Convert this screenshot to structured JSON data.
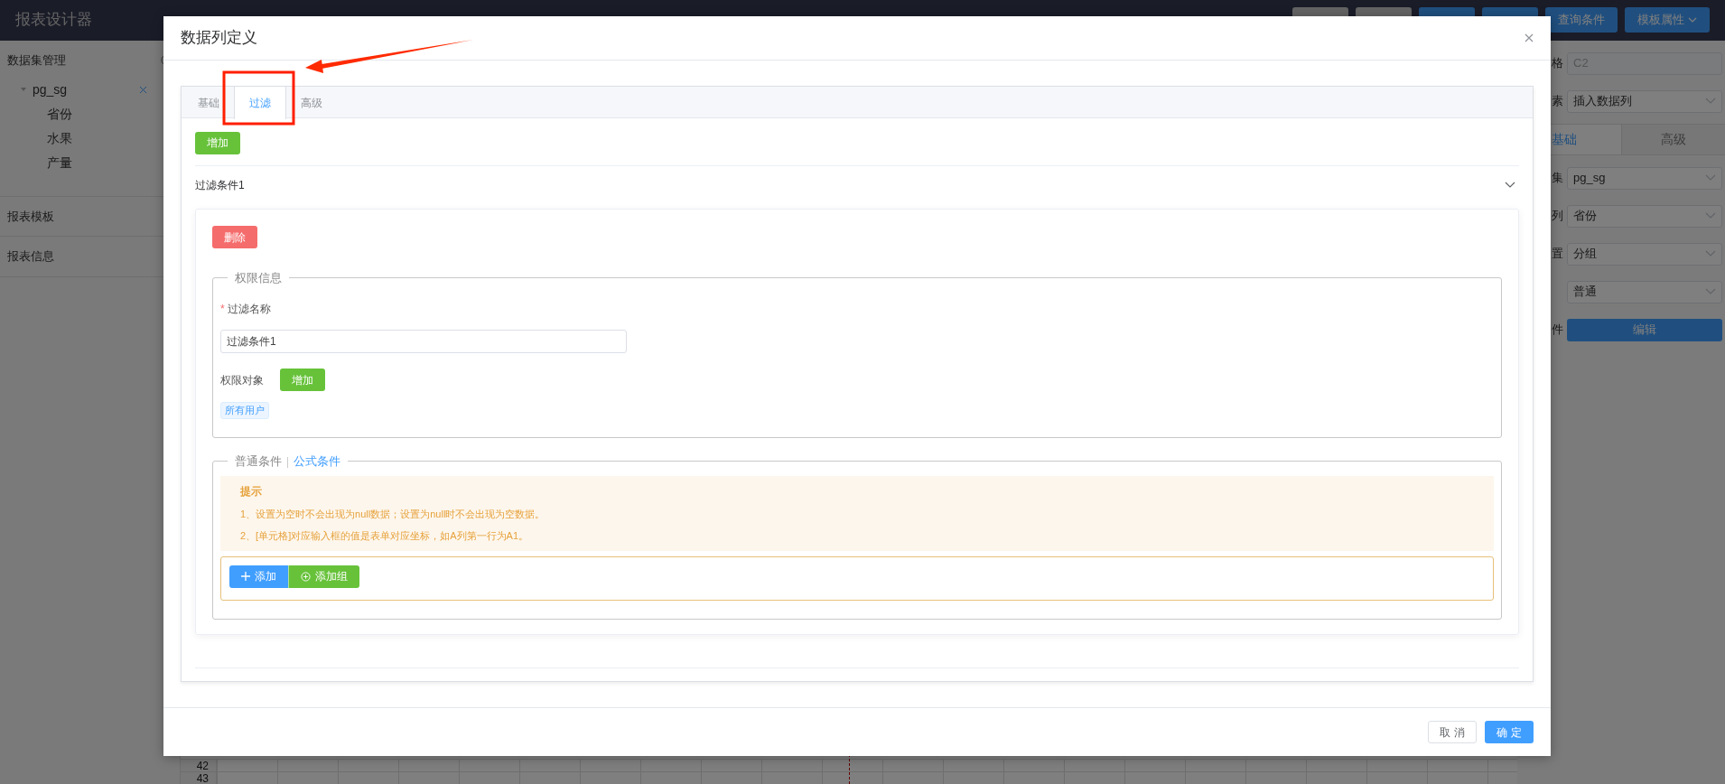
{
  "topbar": {
    "title": "报表设计器",
    "buttons": [
      {
        "kind": "default"
      },
      {
        "kind": "default"
      },
      {
        "kind": "primary"
      },
      {
        "kind": "primary"
      },
      {
        "kind": "primary",
        "label": "查询条件"
      },
      {
        "kind": "primary",
        "label": "模板属性",
        "dropdown": true
      }
    ]
  },
  "sidebar": {
    "sections": [
      {
        "title": "数据集管理",
        "datasets": [
          {
            "name": "pg_sg",
            "expanded": true,
            "children": [
              {
                "name": "省份"
              },
              {
                "name": "水果"
              },
              {
                "name": "产量"
              }
            ]
          }
        ]
      },
      {
        "title": "报表模板"
      },
      {
        "title": "报表信息"
      }
    ]
  },
  "grid": {
    "row_numbers": [
      "42",
      "43"
    ]
  },
  "right_panel": {
    "fields": [
      {
        "label": "格",
        "value": "C2",
        "kind": "input",
        "disabled": true
      },
      {
        "label": "素",
        "value": "插入数据列",
        "kind": "select",
        "disabled": false
      }
    ],
    "tabs": [
      {
        "label": "基础",
        "selected": true
      },
      {
        "label": "高级",
        "selected": false
      }
    ],
    "tab_fields": [
      {
        "label": "集",
        "value": "pg_sg",
        "kind": "select"
      },
      {
        "label": "列",
        "value": "省份",
        "kind": "select"
      },
      {
        "label": "置",
        "value": "分组",
        "kind": "select"
      },
      {
        "value": "普通",
        "kind": "select"
      },
      {
        "label": "件",
        "value": "编辑",
        "kind": "button"
      }
    ]
  },
  "dialog": {
    "title": "数据列定义",
    "tabs": [
      {
        "label": "基础",
        "selected": false
      },
      {
        "label": "过滤",
        "selected": true
      },
      {
        "label": "高级",
        "selected": false
      }
    ],
    "add_button": "增加",
    "filters": [
      {
        "title": "过滤条件1",
        "expanded": true,
        "delete_button": "删除",
        "permission": {
          "legend": "权限信息",
          "name_label": "过滤名称",
          "required_mark": "*",
          "name_value": "过滤条件1",
          "target_label": "权限对象",
          "add_button": "增加",
          "tags": [
            "所有用户"
          ]
        },
        "conditions": {
          "legend_tabs": [
            {
              "label": "普通条件",
              "selected": false
            },
            {
              "label": "公式条件",
              "selected": true
            }
          ],
          "tip": {
            "title": "提示",
            "lines": [
              "1、设置为空时不会出现为null数据；设置为null时不会出现为空数据。",
              "2、[单元格]对应输入框的值是表单对应坐标，如A列第一行为A1。"
            ]
          },
          "buttons": [
            {
              "label": "添加",
              "kind": "add"
            },
            {
              "label": "添加组",
              "kind": "add_group"
            }
          ]
        }
      }
    ],
    "footer_buttons": [
      {
        "label": "取 消",
        "kind": "default"
      },
      {
        "label": "确 定",
        "kind": "primary"
      }
    ]
  }
}
